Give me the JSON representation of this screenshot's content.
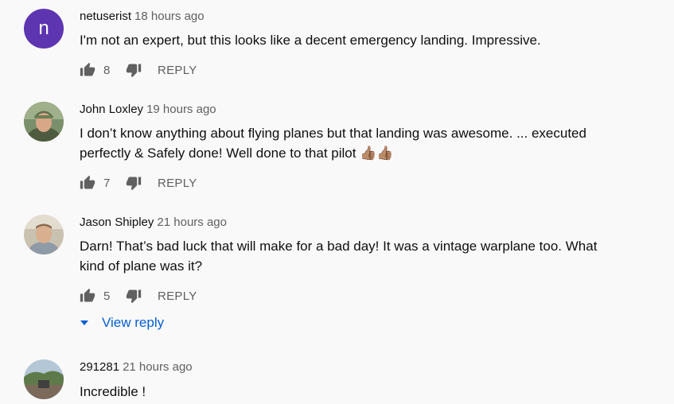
{
  "comments": [
    {
      "author": "netuserist",
      "time": "18 hours ago",
      "avatar_letter": "n",
      "avatar_color": "#5e35b1",
      "text": "I'm not an expert, but this looks like a decent emergency landing. Impressive.",
      "likes": "8",
      "reply_label": "REPLY"
    },
    {
      "author": "John Loxley",
      "time": "19 hours ago",
      "text_line1": "I don’t know anything about flying planes but that landing was awesome. ... executed",
      "text_line2": "perfectly & Safely done! Well done to that pilot 👍🏽👍🏽",
      "likes": "7",
      "reply_label": "REPLY"
    },
    {
      "author": "Jason Shipley",
      "time": "21 hours ago",
      "text_line1": "Darn! That’s bad luck that will make for a bad day! It was a vintage warplane too. What",
      "text_line2": "kind of plane was it?",
      "likes": "5",
      "reply_label": "REPLY",
      "view_reply_label": "View reply"
    },
    {
      "author": "291281",
      "time": "21 hours ago",
      "text": "Incredible !"
    }
  ],
  "colors": {
    "background": "#f9f9f9",
    "link_blue": "#065fd4",
    "secondary_text": "#606060"
  }
}
